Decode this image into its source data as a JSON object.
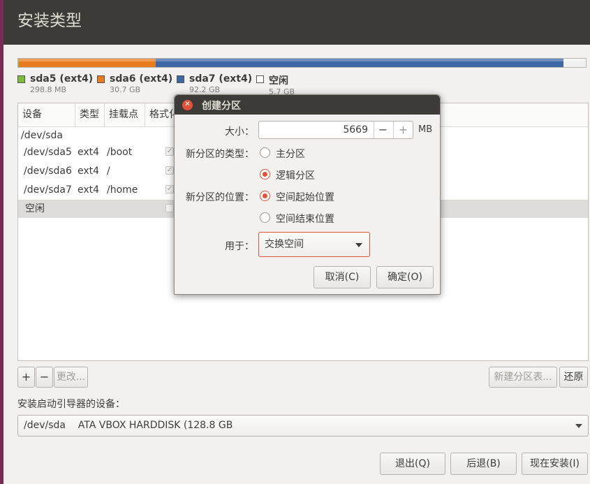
{
  "window": {
    "title": "安装类型"
  },
  "partition_bar": {
    "segments": [
      {
        "name": "sda5",
        "color": "#7bbd3a",
        "fraction": 0.001
      },
      {
        "name": "sda6",
        "color": "#e97b1f",
        "fraction": 0.241
      },
      {
        "name": "sda7",
        "color": "#3e67a6",
        "fraction": 0.716
      },
      {
        "name": "free",
        "color": "#f0f0f0",
        "fraction": 0.042
      }
    ]
  },
  "legend": [
    {
      "name": "sda5 (ext4)",
      "size": "298.8 MB",
      "color": "#7bbd3a"
    },
    {
      "name": "sda6 (ext4)",
      "size": "30.7 GB",
      "color": "#e97b1f"
    },
    {
      "name": "sda7 (ext4)",
      "size": "92.2 GB",
      "color": "#3e67a6"
    },
    {
      "name": "空闲",
      "size": "5.7 GB",
      "color": "#ffffff"
    }
  ],
  "table": {
    "headers": [
      "设备",
      "类型",
      "挂载点",
      "格式化"
    ],
    "rows": [
      {
        "device": "/dev/sda",
        "type": "",
        "mount": "",
        "check": false
      },
      {
        "device": "/dev/sda5",
        "type": "ext4",
        "mount": "/boot",
        "check": true
      },
      {
        "device": "/dev/sda6",
        "type": "ext4",
        "mount": "/",
        "check": true
      },
      {
        "device": "/dev/sda7",
        "type": "ext4",
        "mount": "/home",
        "check": true
      },
      {
        "device": "空闲",
        "type": "",
        "mount": "",
        "check": false
      }
    ]
  },
  "table_buttons": {
    "add": "+",
    "remove": "−",
    "change": "更改...",
    "new_table": "新建分区表...",
    "revert": "还原"
  },
  "bootloader": {
    "label": "安装启动引导器的设备：",
    "selected": "/dev/sda    ATA VBOX HARDDISK (128.8 GB"
  },
  "bottom_buttons": {
    "quit": "退出(Q)",
    "back": "后退(B)",
    "install": "现在安装(I)"
  },
  "dialog": {
    "title": "创建分区",
    "size_label": "大小：",
    "size_value": "5669",
    "minus": "−",
    "plus": "+",
    "unit": "MB",
    "type_label": "新分区的类型：",
    "type_primary": "主分区",
    "type_logical": "逻辑分区",
    "location_label": "新分区的位置：",
    "location_start": "空间起始位置",
    "location_end": "空间结束位置",
    "use_label": "用于：",
    "use_value": "交换空间",
    "cancel": "取消(C)",
    "ok": "确定(O)"
  }
}
